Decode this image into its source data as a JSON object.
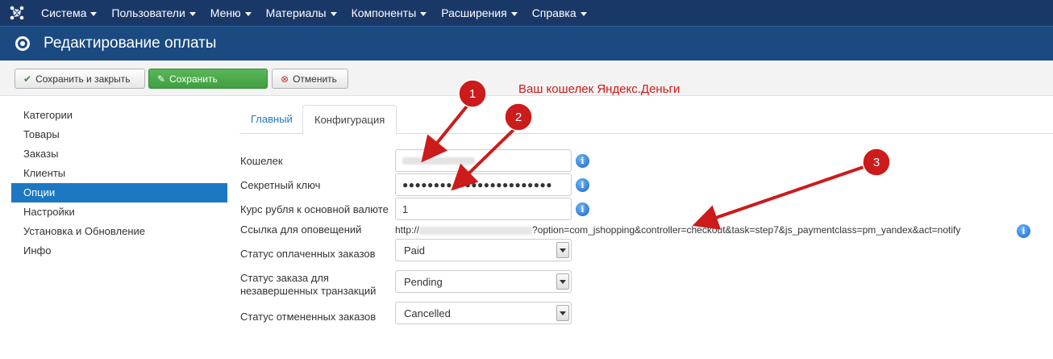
{
  "top_menu": {
    "logo_icon": "joomla-logo-icon",
    "items": [
      {
        "label": "Система"
      },
      {
        "label": "Пользователи"
      },
      {
        "label": "Меню"
      },
      {
        "label": "Материалы"
      },
      {
        "label": "Компоненты"
      },
      {
        "label": "Расширения"
      },
      {
        "label": "Справка"
      }
    ]
  },
  "header": {
    "title": "Редактирование оплаты",
    "icon": "radio-circle-icon"
  },
  "toolbar": {
    "save_close_label": "Сохранить и закрыть",
    "save_label": "Сохранить",
    "cancel_label": "Отменить"
  },
  "annotation": {
    "text": "Ваш кошелек Яндекс.Деньги",
    "badges": [
      "1",
      "2",
      "3"
    ],
    "color": "#cc1b1b"
  },
  "sidebar": {
    "items": [
      {
        "label": "Категории"
      },
      {
        "label": "Товары"
      },
      {
        "label": "Заказы"
      },
      {
        "label": "Клиенты"
      },
      {
        "label": "Опции"
      },
      {
        "label": "Настройки"
      },
      {
        "label": "Установка и Обновление"
      },
      {
        "label": "Инфо"
      }
    ],
    "active": "Опции"
  },
  "tabs": [
    {
      "label": "Главный"
    },
    {
      "label": "Конфигурация"
    }
  ],
  "form": {
    "wallet_label": "Кошелек",
    "secret_label": "Секретный ключ",
    "secret_value": "●●●●●●●●●●●●●●●●●●●●●●●●",
    "rate_label": "Курс рубля к основной валюте",
    "rate_value": "1",
    "notify_label": "Ссылка для оповещений",
    "notify_prefix": "http://",
    "notify_suffix": "?option=com_jshopping&controller=checkout&task=step7&js_paymentclass=pm_yandex&act=notify",
    "paid_label": "Статус оплаченных заказов",
    "paid_value": "Paid",
    "pending_label_line1": "Статус заказа для",
    "pending_label_line2": "незавершенных транзакций",
    "pending_value": "Pending",
    "cancelled_label": "Статус отмененных заказов",
    "cancelled_value": "Cancelled"
  },
  "colors": {
    "topbar": "#1a3867",
    "titlebar": "#1a4a80",
    "save_button": "#46a546",
    "active_nav": "#1d78c3",
    "link": "#1d78c3"
  }
}
